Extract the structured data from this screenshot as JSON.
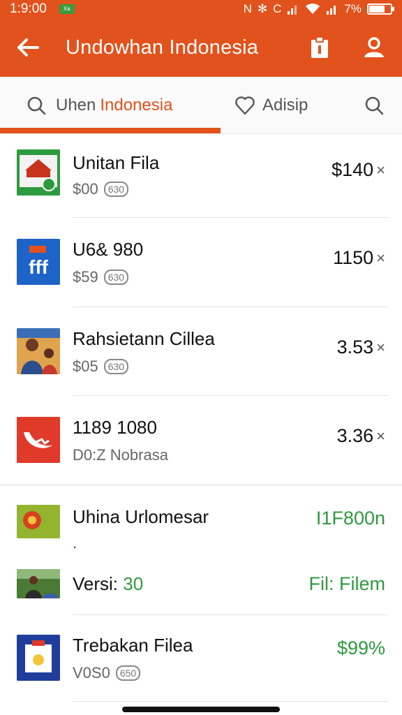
{
  "status_bar": {
    "time": "1:9:00",
    "notification_label": "Xa",
    "right_text": "7%"
  },
  "app_bar": {
    "title": "Undowhan Indonesia"
  },
  "tabs": [
    {
      "label_a": "Uhen",
      "label_b": "Indonesia",
      "active": true
    },
    {
      "label": "Adisip"
    }
  ],
  "items": [
    {
      "name": "Unitan Fila",
      "sub": "$00",
      "badge": "630",
      "price": "$140",
      "suffix": "×"
    },
    {
      "name": "U6& 980",
      "sub": "$59",
      "badge": "630",
      "price": "1150",
      "suffix": "×"
    },
    {
      "name": "Rahsietann Cillea",
      "sub": "$05",
      "badge": "630",
      "price": "3.53",
      "suffix": "×"
    },
    {
      "name": "1189 1080",
      "sub": "D0:Z Nobrasa",
      "price": "3.36",
      "suffix": "×"
    },
    {
      "name": "Uhina Urlomesar",
      "sub": ".",
      "price": "I1F800n"
    },
    {
      "name": "Versi: ",
      "name_green": "30",
      "price": "Fil: Filem"
    },
    {
      "name": "Trebakan Filea",
      "sub": "V0S0",
      "badge": "650",
      "price": "$99%"
    }
  ],
  "colors": {
    "brand": "#e2521c",
    "green_text": "#2e9a3e"
  }
}
